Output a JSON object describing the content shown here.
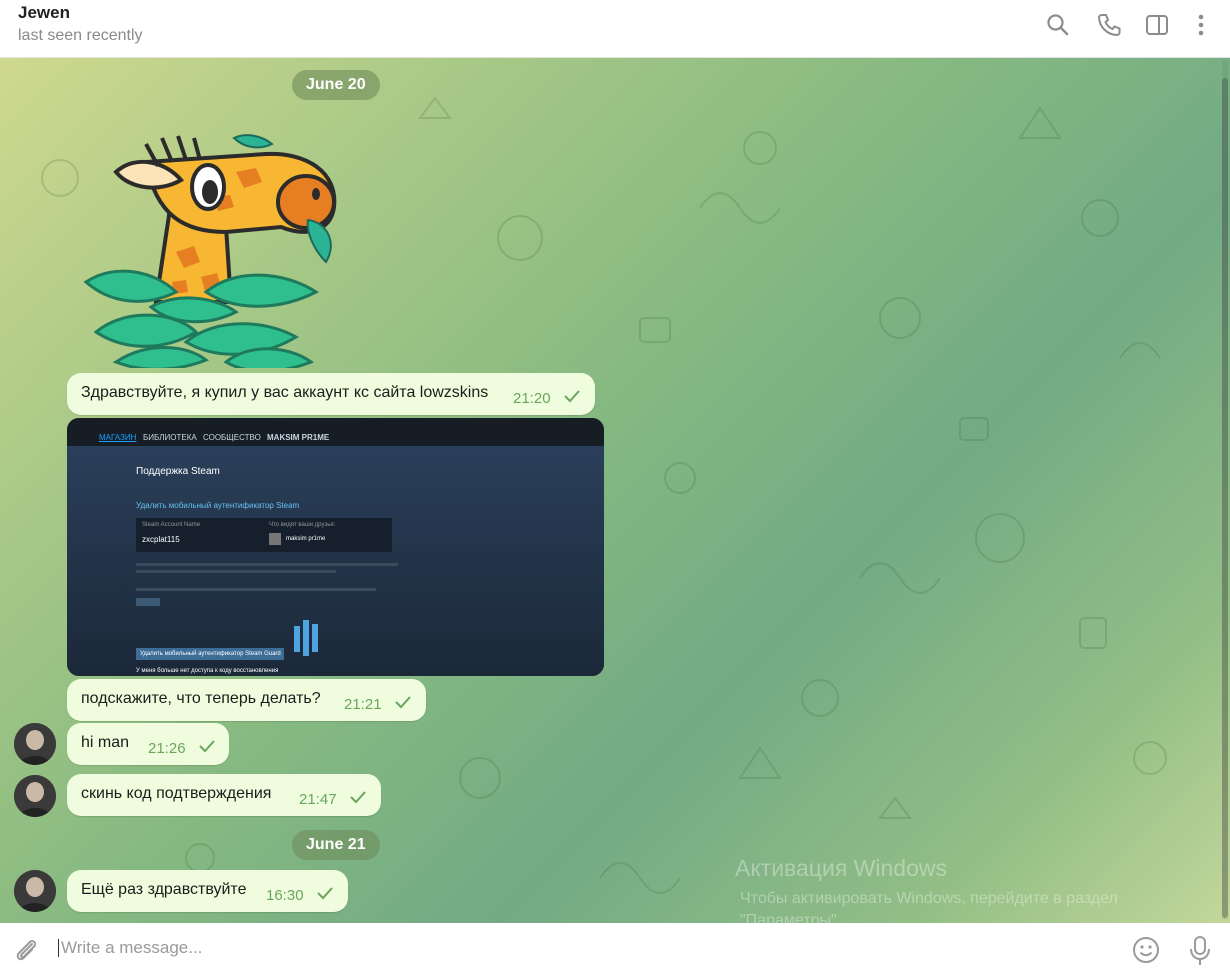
{
  "header": {
    "name": "Jewen",
    "status": "last seen recently",
    "icons": [
      "search-icon",
      "phone-icon",
      "sidebar-toggle-icon",
      "more-vertical-icon"
    ]
  },
  "chat": {
    "dates": [
      "June 20",
      "June 21"
    ],
    "screenshot": {
      "nav": [
        "МАГАЗИН",
        "БИБЛИОТЕКА",
        "СООБЩЕСТВО",
        "MAKSIM PR1ME"
      ],
      "title": "Поддержка Steam",
      "subtitle": "Удалить мобильный аутентификатор Steam",
      "account_label": "Steam Account Name",
      "account_value": "zxcplat115",
      "friends_label": "Что видят ваши друзья:",
      "friends_value": "maksim pr1me",
      "button": "Удалить мобильный аутентификатор Steam Guard",
      "footer": "У меня больше нет доступа к коду восстановления"
    },
    "messages": [
      {
        "text": "Здравствуйте, я купил у вас аккаунт кс сайта lowzskins",
        "time": "21:20"
      },
      {
        "text": "подскажите, что теперь делать?",
        "time": "21:21"
      },
      {
        "text": "hi man",
        "time": "21:26"
      },
      {
        "text": "скинь код подтверждения",
        "time": "21:47"
      },
      {
        "text": "Ещё раз здравствуйте",
        "time": "16:30"
      }
    ],
    "watermark": {
      "title": "Активация Windows",
      "line": "Чтобы активировать Windows, перейдите в раздел \"Параметры\"."
    }
  },
  "composer": {
    "placeholder": "Write a message...",
    "icons": [
      "attach-icon",
      "emoji-icon",
      "microphone-icon"
    ]
  },
  "colors": {
    "bubble": "#effdde",
    "time": "#6aa55d",
    "date_pill": "#6e8c5a"
  }
}
